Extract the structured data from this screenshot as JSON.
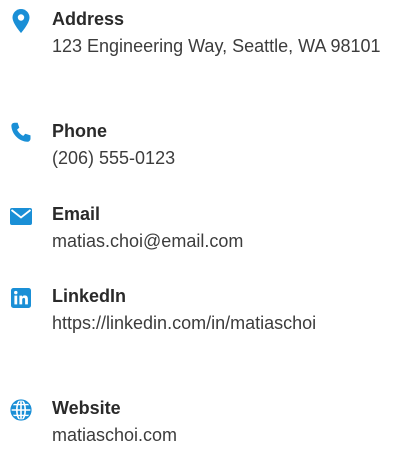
{
  "colors": {
    "accent": "#1a8fd6",
    "label": "#2a2a2a",
    "value": "#3c3c3c"
  },
  "contact": {
    "address": {
      "icon": "map-pin-icon",
      "label": "Address",
      "value": "123 Engineering Way, Seattle, WA 98101"
    },
    "phone": {
      "icon": "phone-icon",
      "label": "Phone",
      "value": "(206) 555-0123"
    },
    "email": {
      "icon": "envelope-icon",
      "label": "Email",
      "value": "matias.choi@email.com"
    },
    "linkedin": {
      "icon": "linkedin-icon",
      "label": "LinkedIn",
      "value": "https://linkedin.com/in/matiaschoi"
    },
    "website": {
      "icon": "globe-icon",
      "label": "Website",
      "value": "matiaschoi.com"
    }
  }
}
